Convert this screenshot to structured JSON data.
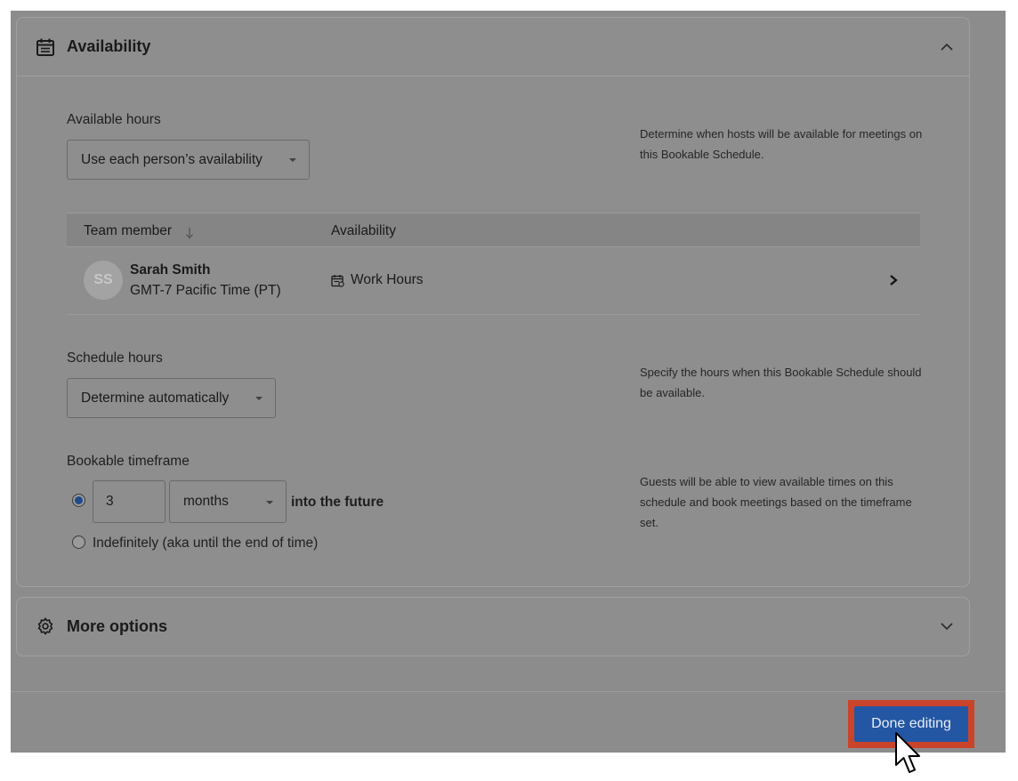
{
  "availability_panel": {
    "title": "Availability",
    "icon": "calendar-icon",
    "collapse_icon": "chevron-up-icon",
    "available_hours": {
      "label": "Available hours",
      "selected": "Use each person’s availability",
      "help": "Determine when hosts will be available for meetings on this Bookable Schedule."
    },
    "team_table": {
      "columns": [
        "Team member",
        "Availability"
      ],
      "sort_icon": "arrow-down-icon",
      "rows": [
        {
          "initials": "SS",
          "name": "Sarah Smith",
          "timezone": "GMT-7 Pacific Time (PT)",
          "availability": "Work Hours"
        }
      ]
    },
    "schedule_hours": {
      "label": "Schedule hours",
      "selected": "Determine automatically",
      "help": "Specify the hours when this Bookable Schedule should be available."
    },
    "bookable_timeframe": {
      "label": "Bookable timeframe",
      "amount": "3",
      "unit": "months",
      "suffix": "into the future",
      "option_indefinite": "Indefinitely (aka until the end of time)",
      "selected_option": "limited",
      "help": "Guests will be able to view available times on this schedule and book meetings based on the timeframe set."
    }
  },
  "more_options_panel": {
    "title": "More options",
    "icon": "gear-icon",
    "expand_icon": "chevron-down-icon"
  },
  "footer": {
    "done_label": "Done editing",
    "highlight_color": "#c9442a",
    "button_color": "#2356a3"
  }
}
